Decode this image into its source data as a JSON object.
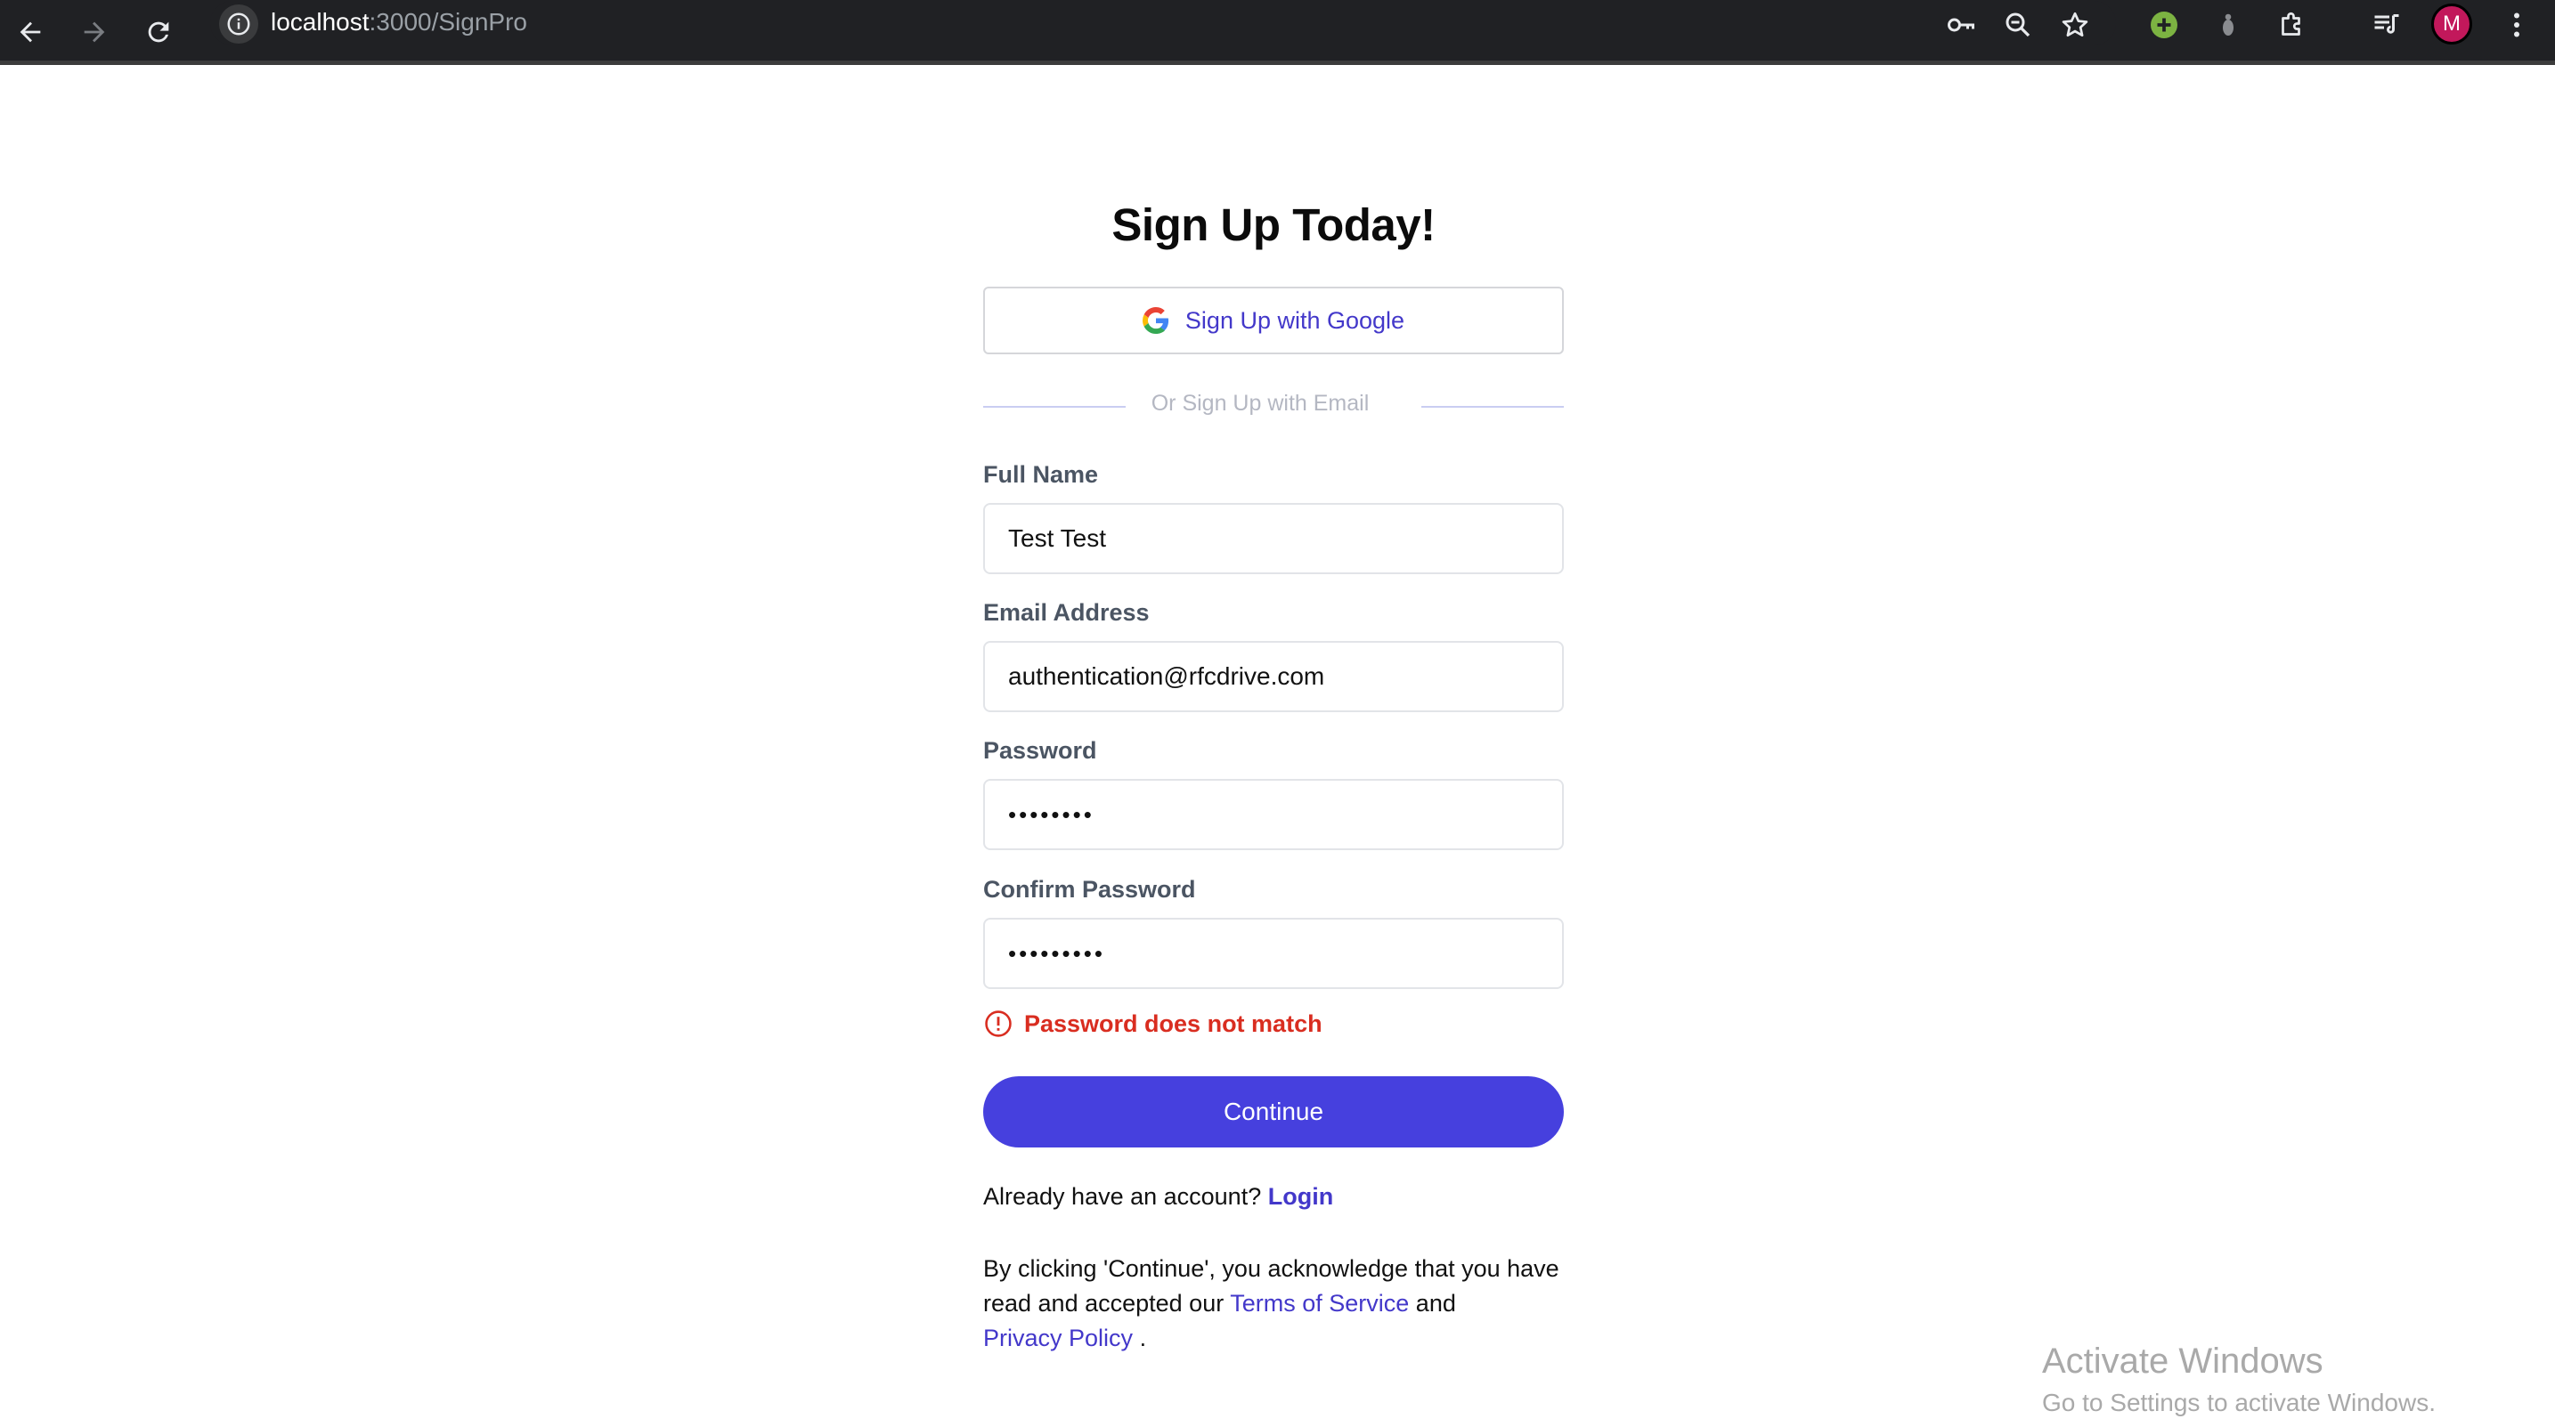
{
  "browser": {
    "url_host": "localhost",
    "url_path": ":3000/SignPro",
    "avatar_initial": "M"
  },
  "icons": {
    "back": "back-arrow-icon",
    "forward": "forward-arrow-icon",
    "reload": "reload-icon",
    "site_info": "info-icon",
    "password_key": "key-icon",
    "zoom": "zoom-icon",
    "bookmark": "star-icon",
    "extension_green": "plus-circle-icon",
    "extension_gray": "extension-icon",
    "extensions": "puzzle-icon",
    "media": "media-queue-icon",
    "menu": "kebab-menu-icon",
    "google": "google-g-icon",
    "error": "alert-circle-icon"
  },
  "colors": {
    "primary": "#4640de",
    "link": "#4338ca",
    "error": "#d92d20",
    "avatar": "#c2185b"
  },
  "form": {
    "title": "Sign Up Today!",
    "google_button": "Sign Up with Google",
    "divider_text": "Or Sign Up with Email",
    "full_name_label": "Full Name",
    "full_name_value": "Test Test",
    "email_label": "Email Address",
    "email_value": "authentication@rfcdrive.com",
    "password_label": "Password",
    "password_value": "••••••••",
    "confirm_password_label": "Confirm Password",
    "confirm_password_value": "•••••••••",
    "error_message": "Password does not match",
    "continue_button": "Continue",
    "already_text": "Already have an account?",
    "login_link": "Login",
    "terms_prefix": "By clicking 'Continue', you acknowledge that you have read and accepted our",
    "terms_link": "Terms of Service",
    "terms_and": "and",
    "privacy_link": "Privacy Policy",
    "terms_end": "."
  },
  "watermark": {
    "title": "Activate Windows",
    "subtitle": "Go to Settings to activate Windows."
  }
}
